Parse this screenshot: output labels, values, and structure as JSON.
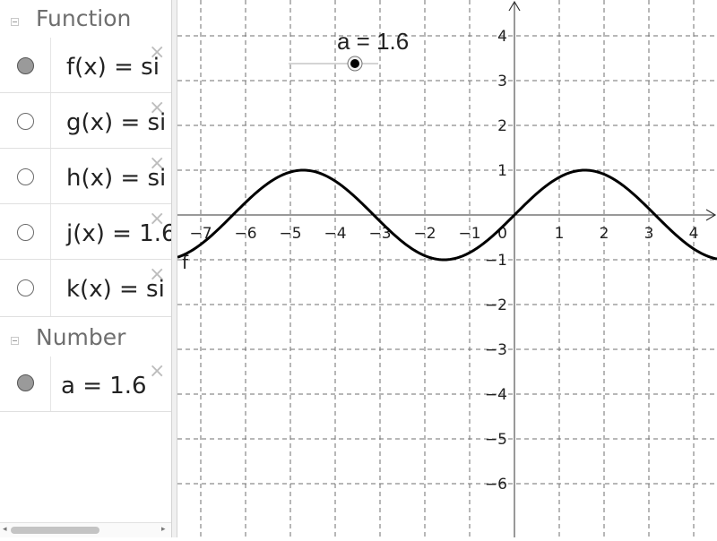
{
  "algebra": {
    "function_group": {
      "label": "Function"
    },
    "functions": [
      {
        "expr": "f(x) = si",
        "visible": true
      },
      {
        "expr": "g(x) = si",
        "visible": false
      },
      {
        "expr": "h(x) = si",
        "visible": false
      },
      {
        "expr": "j(x) = 1.6",
        "visible": false
      },
      {
        "expr": "k(x) = si",
        "visible": false
      }
    ],
    "number_group": {
      "label": "Number"
    },
    "numbers": [
      {
        "expr": "a = 1.6",
        "visible": true
      }
    ],
    "delete_icon": "×"
  },
  "graphics": {
    "x_ticks": [
      -7,
      -6,
      -5,
      -4,
      -3,
      -2,
      -1,
      1,
      2,
      3,
      4
    ],
    "y_ticks": [
      4,
      3,
      2,
      1,
      -1,
      -2,
      -3,
      -4,
      -5,
      -6
    ],
    "origin_label": "0",
    "curve_label": "f",
    "slider": {
      "label": "a = 1.6",
      "value": 1.6
    }
  },
  "chart_data": {
    "type": "line",
    "function": "sin(x)",
    "series": [
      {
        "name": "f"
      }
    ],
    "xlim": [
      -7.8,
      4.5
    ],
    "ylim": [
      -6.7,
      4.8
    ],
    "grid": true
  }
}
